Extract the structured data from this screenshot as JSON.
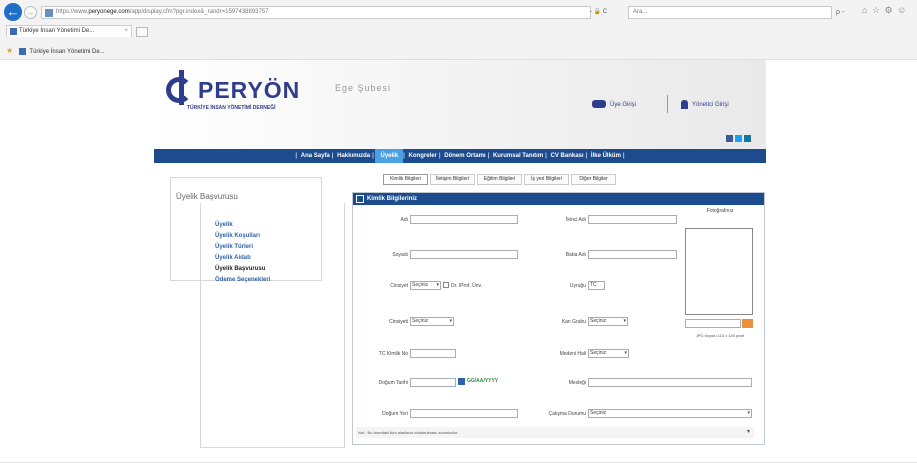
{
  "browser": {
    "url_prefix": "https://www.",
    "url_host": "peryonege.com",
    "url_path": "/app/display.cfm?pgr.index&_randr=1597438893757",
    "addr_right": "- 🔒 C",
    "search_text": "Ara...",
    "search_controls": "ρ - ",
    "right_icons": "⌂ ☆ ⚙ ☺",
    "tab_label": "Türkiye İnsan Yönetimi De...",
    "tab_close": "×",
    "favorite_label": "Türkiye İnsan Yönetimi De..."
  },
  "header": {
    "logo_text": "PERYÖN",
    "logo_branch": "Ege Şubesi",
    "logo_subtitle": "TÜRKİYE İNSAN YÖNETİMİ DERNEĞİ",
    "member_login": "Üye Girişi",
    "admin_login": "Yönetici Girişi",
    "social_colors": [
      "#3b5998",
      "#1da1f2",
      "#0e76a8"
    ]
  },
  "menu": {
    "items": [
      "Ana Sayfa",
      "Hakkımızda",
      "Üyelik",
      "Kongreler",
      "Dönem Ortamı",
      "Kurumsal Tanıtım",
      "CV Bankası",
      "İlke Ülküm"
    ],
    "separator": "|"
  },
  "sidebar": {
    "title": "Üyelik Başvurusu",
    "links": [
      "Üyelik",
      "Üyelik Koşulları",
      "Üyelik Türleri",
      "Üyelik Aidatı",
      "Üyelik Başvurusu",
      "Ödeme Seçenekleri"
    ]
  },
  "tabs": [
    "Kimlik Bilgileri",
    "İletişim Bilgileri",
    "Eğitim Bilgileri",
    "İş yeri Bilgileri",
    "Diğer Bilgiler"
  ],
  "form": {
    "title": "Kimlik Bilgileriniz",
    "fields": {
      "ad": "Adı",
      "ikinci_ad": "İkinci Adı",
      "soyadi": "Soyadı",
      "baba_adi": "Baba Adı",
      "cinsiyet": "Cinsiyet",
      "cinsiyet_value": "Seçiniz",
      "dr_prof_unv": "Dr. /Prof. Ünv.",
      "uyrugu": "Uyruğu",
      "uyrugu_value": "TC",
      "cinsiyeti2": "Cinsiyeti",
      "cinsiyeti2_value": "Seçiniz",
      "kan_grubu": "Kan Grubu",
      "kan_grubu_value": "Seçiniz",
      "tc_kimlik": "TC Kimlik No",
      "medeni_hal": "Medeni Hali",
      "medeni_hal_value": "Seçiniz",
      "dogum_tarihi": "Doğum Tarihi",
      "date_format": "GG/AA/YYYY",
      "meslegi": "Mesleği",
      "dogum_yeri": "Doğum Yeri",
      "calisma_durumu": "Çalışma Durumu",
      "calisma_durumu_value": "Seçiniz"
    },
    "photo_label": "Fotoğrafınız",
    "photo_note": "JPG boyutu 113 x 140 pixel",
    "footer_note": "Not : Bu formdaki tüm alanların doldurulması zorunludur.",
    "footer_dropdown": "▾"
  }
}
